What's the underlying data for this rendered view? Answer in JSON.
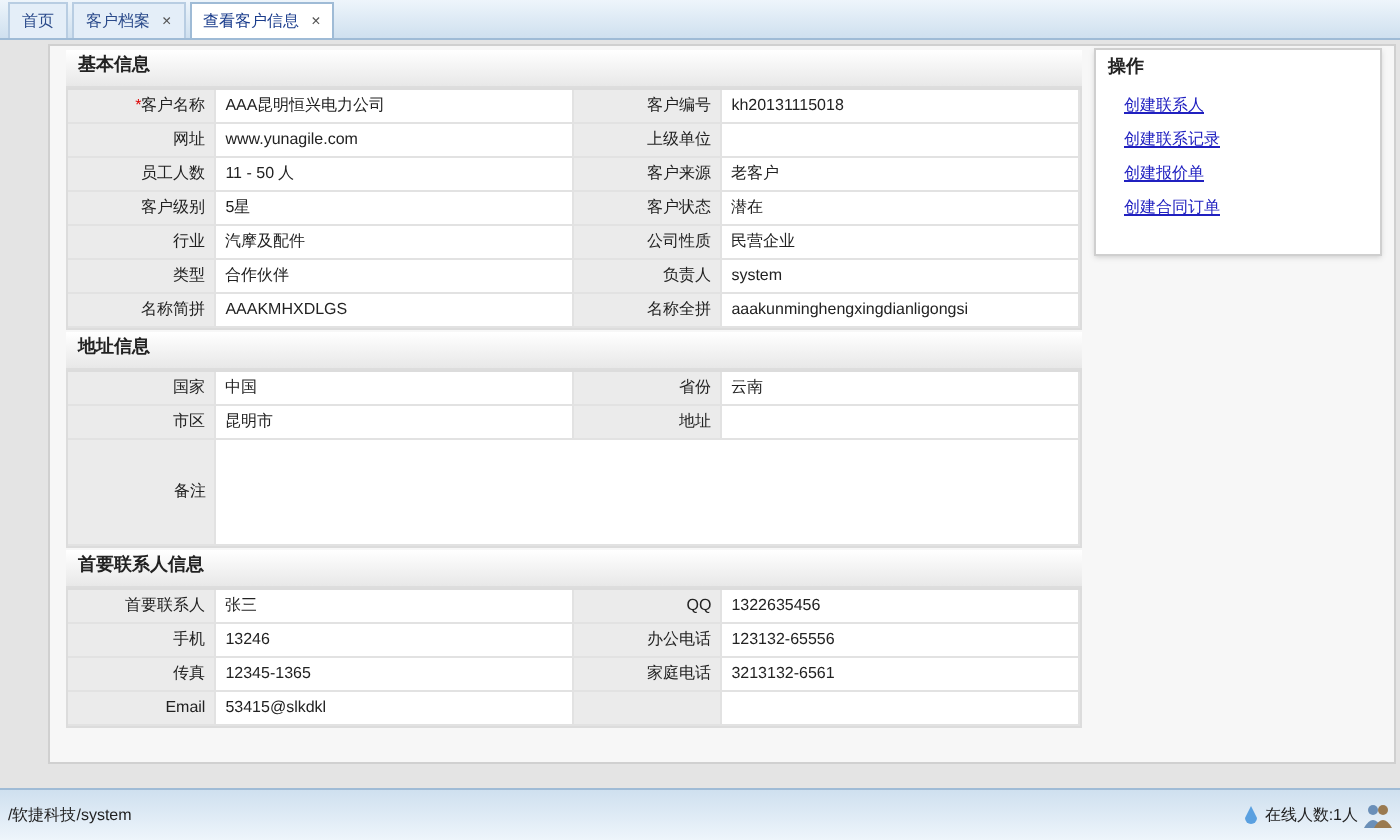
{
  "tabs": [
    {
      "label": "首页",
      "selected": false
    },
    {
      "label": "客户档案",
      "close": "×",
      "selected": false
    },
    {
      "label": "查看客户信息",
      "close": "×",
      "selected": true
    }
  ],
  "sections": [
    {
      "title": "基本信息",
      "rows": [
        [
          {
            "label": "客户名称",
            "marker": "*",
            "value": "AAA昆明恒兴电力公司"
          },
          {
            "label": "客户编号",
            "value": "kh20131115018"
          }
        ],
        [
          {
            "label": "网址",
            "value": "www.yunagile.com"
          },
          {
            "label": "上级单位"
          }
        ],
        [
          {
            "label": "员工人数",
            "value": "11 - 50 人"
          },
          {
            "label": "客户来源",
            "value": "老客户"
          }
        ],
        [
          {
            "label": "客户级别",
            "value": "5星"
          },
          {
            "label": "客户状态",
            "value": "潜在"
          }
        ],
        [
          {
            "label": "行业",
            "value": "汽摩及配件"
          },
          {
            "label": "公司性质",
            "value": "民营企业"
          }
        ],
        [
          {
            "label": "类型",
            "value": "合作伙伴"
          },
          {
            "label": "负责人",
            "value": "system"
          }
        ],
        [
          {
            "label": "名称简拼",
            "value": "AAAKMHXDLGS"
          },
          {
            "label": "名称全拼",
            "value": "aaakunminghengxingdianligongsi"
          }
        ]
      ]
    },
    {
      "title": "地址信息",
      "rows": [
        [
          {
            "label": "国家",
            "value": "中国"
          },
          {
            "label": "省份",
            "value": "云南"
          }
        ],
        [
          {
            "label": "市区",
            "value": "昆明市"
          },
          {
            "label": "地址"
          }
        ],
        [
          {
            "label": "备注",
            "kind": "wide"
          }
        ]
      ]
    },
    {
      "title": "首要联系人信息",
      "rows": [
        [
          {
            "label": "首要联系人",
            "value": "张三"
          },
          {
            "label": "QQ",
            "value": "1322635456"
          }
        ],
        [
          {
            "label": "手机",
            "value": "13246"
          },
          {
            "label": "办公电话",
            "value": "123132-65556"
          }
        ],
        [
          {
            "label": "传真",
            "value": "12345-1365"
          },
          {
            "label": "家庭电话",
            "value": "3213132-6561"
          }
        ],
        [
          {
            "label": "Email",
            "value": "53415@slkdkl"
          },
          {}
        ]
      ]
    }
  ],
  "actions": {
    "title": "操作",
    "links": [
      "创建联系人",
      "创建联系记录",
      "创建报价单",
      "创建合同订单"
    ]
  },
  "status_bar": {
    "path": "/软捷科技/system",
    "online": "在线人数:1人"
  }
}
